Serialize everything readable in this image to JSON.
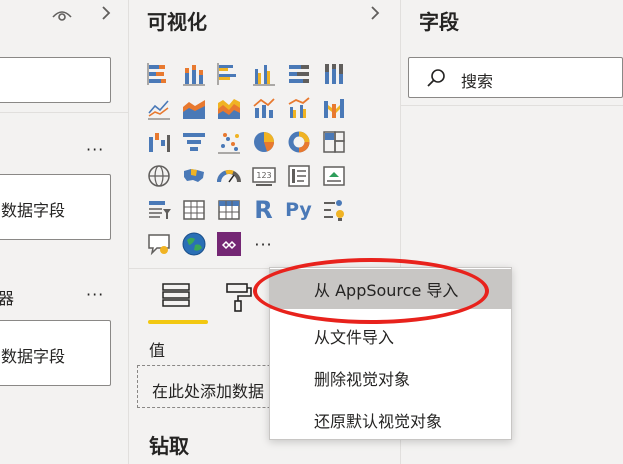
{
  "filters": {
    "section1_more": "···",
    "field1_text": "数据字段",
    "section2_label": "器",
    "section2_more": "···",
    "field2_text": "数据字段"
  },
  "viz": {
    "title": "可视化",
    "expand": "›",
    "more_visuals": "···",
    "r_icon": "R",
    "py_icon": "Py",
    "values_label": "值",
    "values_placeholder": "在此处添加数据",
    "drill_title": "钻取"
  },
  "fields": {
    "title": "字段",
    "search_placeholder": "搜索"
  },
  "context_menu": {
    "items": [
      {
        "label": "从 AppSource 导入"
      },
      {
        "label": "从文件导入"
      },
      {
        "label": "删除视觉对象"
      },
      {
        "label": "还原默认视觉对象"
      }
    ]
  },
  "colors": {
    "accent": "#f2c811",
    "highlight_oval": "#e8221c",
    "chart_blue": "#4a79b7",
    "chart_orange": "#e8792f",
    "chart_yellow": "#f0b323"
  }
}
